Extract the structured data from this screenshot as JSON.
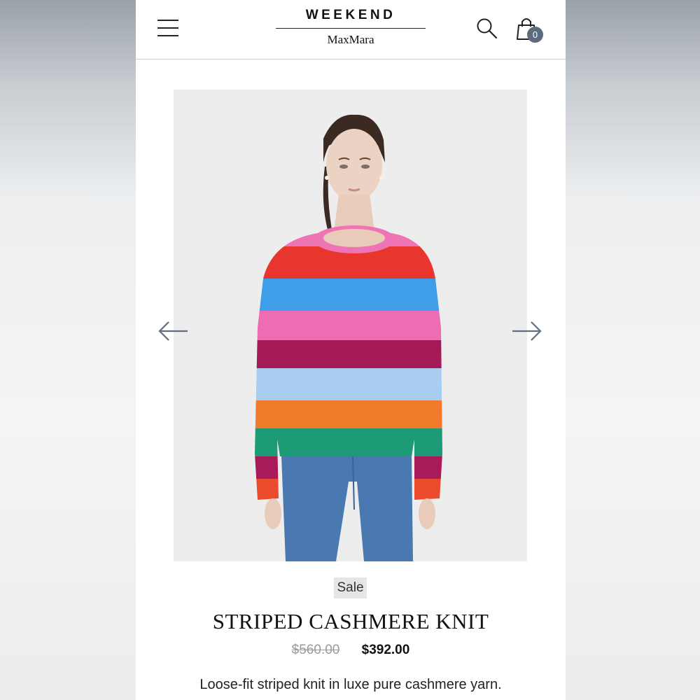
{
  "header": {
    "brand_top": "WEEKEND",
    "brand_bottom": "MaxMara",
    "menu_icon": "hamburger-menu-icon",
    "search_icon": "search-icon",
    "bag_icon": "shopping-bag-icon",
    "bag_count": "0"
  },
  "gallery": {
    "image_description": "model wearing multicolor striped cashmere sweater and blue jeans",
    "prev_icon": "arrow-left-icon",
    "next_icon": "arrow-right-icon"
  },
  "product": {
    "badge": "Sale",
    "title": "STRIPED CASHMERE KNIT",
    "price_original": "$560.00",
    "price_sale": "$392.00",
    "description": "Loose-fit striped knit in luxe pure cashmere yarn."
  },
  "colors": {
    "badge_bg": "#e4e6e8",
    "bag_badge_bg": "#5d6c7d",
    "arrow": "#5f6f80"
  }
}
